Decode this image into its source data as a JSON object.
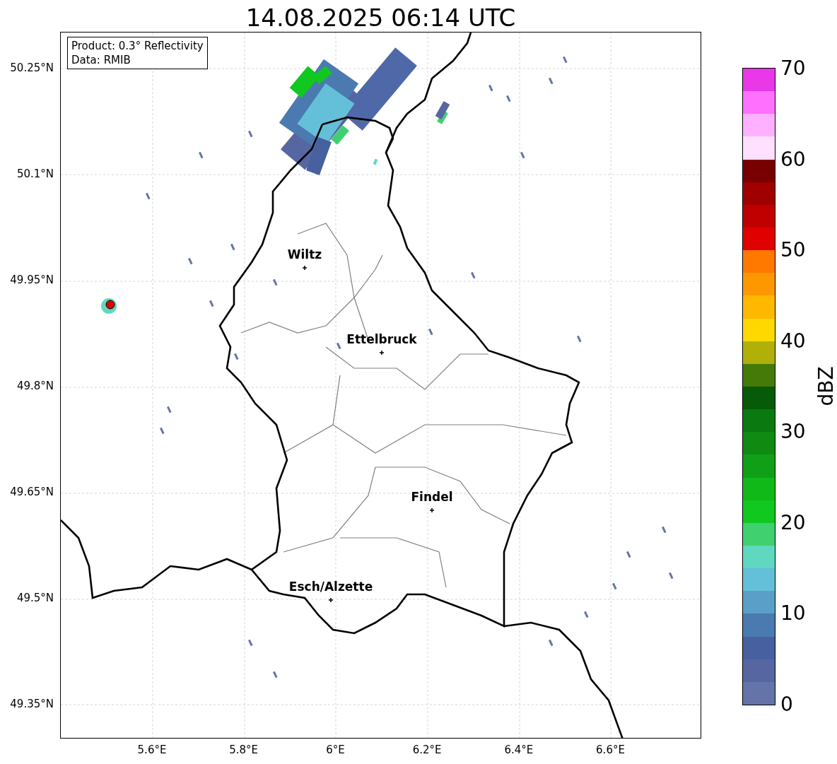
{
  "title": "14.08.2025 06:14 UTC",
  "info_box": {
    "lines": [
      "Product: 0.3° Reflectivity",
      "Data: RMIB"
    ]
  },
  "map": {
    "cities": [
      {
        "label": "Wiltz"
      },
      {
        "label": "Ettelbruck"
      },
      {
        "label": "Findel"
      },
      {
        "label": "Esch/Alzette"
      }
    ],
    "y_ticks": [
      "50.25°N",
      "50.1°N",
      "49.95°N",
      "49.8°N",
      "49.65°N",
      "49.5°N",
      "49.35°N"
    ],
    "x_ticks": [
      "5.6°E",
      "5.8°E",
      "6°E",
      "6.2°E",
      "6.4°E",
      "6.6°E"
    ]
  },
  "colorbar": {
    "label": "dBZ",
    "ticks": [
      "70",
      "60",
      "50",
      "40",
      "30",
      "20",
      "10",
      "0"
    ],
    "bins": [
      {
        "color": "#6574a8"
      },
      {
        "color": "#5666a0"
      },
      {
        "color": "#4660a0"
      },
      {
        "color": "#4a7ab0"
      },
      {
        "color": "#5a9fc8"
      },
      {
        "color": "#64c0d8"
      },
      {
        "color": "#60d8c0"
      },
      {
        "color": "#40d070"
      },
      {
        "color": "#10c820"
      },
      {
        "color": "#10b818"
      },
      {
        "color": "#10a018"
      },
      {
        "color": "#108a10"
      },
      {
        "color": "#0a7a10"
      },
      {
        "color": "#065a08"
      },
      {
        "color": "#457a08"
      },
      {
        "color": "#b0b008"
      },
      {
        "color": "#ffd800"
      },
      {
        "color": "#ffb800"
      },
      {
        "color": "#ff9800"
      },
      {
        "color": "#ff7800"
      },
      {
        "color": "#e00000"
      },
      {
        "color": "#c00000"
      },
      {
        "color": "#a00000"
      },
      {
        "color": "#780000"
      },
      {
        "color": "#ffe0ff"
      },
      {
        "color": "#ffb0ff"
      },
      {
        "color": "#ff70ff"
      },
      {
        "color": "#e838e8"
      }
    ]
  }
}
